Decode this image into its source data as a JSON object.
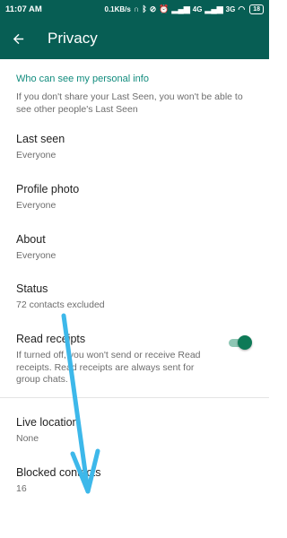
{
  "status_bar": {
    "time": "11:07 AM",
    "net_speed": "0.1KB/s",
    "net1": "4G",
    "net2": "3G",
    "battery": "18"
  },
  "header": {
    "title": "Privacy",
    "back_icon": "arrow-left-icon"
  },
  "section": {
    "title": "Who can see my personal info",
    "description": "If you don't share your Last Seen, you won't be able to see other people's Last Seen"
  },
  "items": [
    {
      "title": "Last seen",
      "subtitle": "Everyone"
    },
    {
      "title": "Profile photo",
      "subtitle": "Everyone"
    },
    {
      "title": "About",
      "subtitle": "Everyone"
    },
    {
      "title": "Status",
      "subtitle": "72 contacts excluded"
    },
    {
      "title": "Read receipts",
      "subtitle": "If turned off, you won't send or receive Read receipts. Read receipts are always sent for group chats.",
      "toggle_on": true
    },
    {
      "title": "Live location",
      "subtitle": "None"
    },
    {
      "title": "Blocked contacts",
      "subtitle": "16"
    }
  ],
  "colors": {
    "primary_dark": "#075e54",
    "accent": "#128c7e",
    "toggle_thumb": "#0e7a57",
    "annotation_arrow": "#3db8ea"
  }
}
